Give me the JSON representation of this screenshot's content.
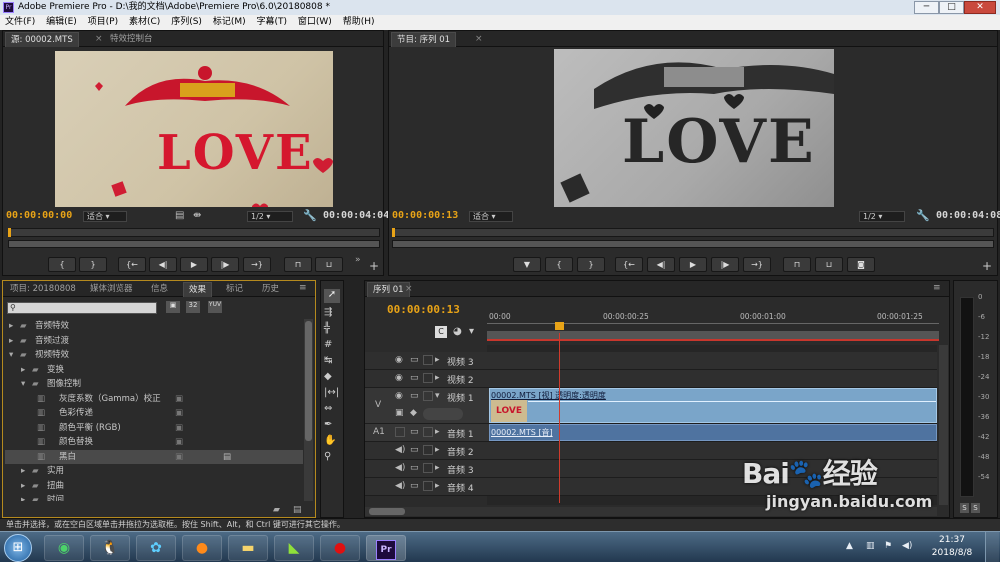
{
  "window": {
    "title": "Adobe Premiere Pro - D:\\我的文档\\Adobe\\Premiere Pro\\6.0\\20180808 *",
    "app_icon": "Pr",
    "minimize": "─",
    "maximize": "□",
    "close": "✕"
  },
  "menu": [
    "文件(F)",
    "编辑(E)",
    "项目(P)",
    "素材(C)",
    "序列(S)",
    "标记(M)",
    "字幕(T)",
    "窗口(W)",
    "帮助(H)"
  ],
  "source_monitor": {
    "tab_source": "源: 00002.MTS",
    "tab_effect_controls": "特效控制台",
    "timecode_in": "00:00:00:00",
    "fit": "适合",
    "resolution": "1/2",
    "duration": "00:00:04:04",
    "frame_text": "LOVE"
  },
  "program_monitor": {
    "tab": "节目: 序列 01",
    "timecode": "00:00:00:13",
    "fit": "适合",
    "resolution": "1/2",
    "duration": "00:00:04:08",
    "frame_text": "LOVE"
  },
  "project_panel": {
    "tabs": [
      "项目: 20180808",
      "媒体浏览器",
      "信息",
      "效果",
      "标记",
      "历史"
    ],
    "active_tab": "效果",
    "tree": [
      {
        "label": "音频特效",
        "level": 0,
        "expanded": false,
        "folder": true
      },
      {
        "label": "音频过渡",
        "level": 0,
        "expanded": false,
        "folder": true
      },
      {
        "label": "视频特效",
        "level": 0,
        "expanded": true,
        "folder": true
      },
      {
        "label": "变换",
        "level": 1,
        "expanded": false,
        "folder": true
      },
      {
        "label": "图像控制",
        "level": 1,
        "expanded": true,
        "folder": true
      },
      {
        "label": "灰度系数（Gamma）校正",
        "level": 2,
        "folder": false
      },
      {
        "label": "色彩传递",
        "level": 2,
        "folder": false
      },
      {
        "label": "颜色平衡 (RGB)",
        "level": 2,
        "folder": false
      },
      {
        "label": "颜色替换",
        "level": 2,
        "folder": false
      },
      {
        "label": "黑白",
        "level": 2,
        "folder": false,
        "selected": true
      },
      {
        "label": "实用",
        "level": 1,
        "expanded": false,
        "folder": true
      },
      {
        "label": "扭曲",
        "level": 1,
        "expanded": false,
        "folder": true
      },
      {
        "label": "时间",
        "level": 1,
        "expanded": false,
        "folder": true
      }
    ]
  },
  "timeline": {
    "tab": "序列 01",
    "timecode": "00:00:00:13",
    "ruler": [
      "00:00",
      "00:00:00:25",
      "00:00:01:00",
      "00:00:01:25"
    ],
    "video_header": "V",
    "audio_header": "A1",
    "video_tracks": [
      "视频 3",
      "视频 2",
      "视频 1"
    ],
    "audio_tracks": [
      "音频 1",
      "音频 2",
      "音频 3",
      "音频 4"
    ],
    "clip_video_label": "00002.MTS [视] 透明度:透明度",
    "clip_audio_label": "00002.MTS [音]"
  },
  "meter_scale": [
    "0",
    "-6",
    "-12",
    "-18",
    "-24",
    "-30",
    "-36",
    "-42",
    "-48",
    "-54"
  ],
  "meter_buttons": [
    "S",
    "S"
  ],
  "status_bar": "单击并选择，或在空白区域单击并拖拉为选取框。按住 Shift、Alt，和 Ctrl 键可进行其它操作。",
  "taskbar": {
    "time": "21:37",
    "date": "2018/8/8",
    "apps": [
      "360",
      "QQ",
      "媒体",
      "Firefox",
      "资源管理器",
      "播放器",
      "录屏",
      "Pr"
    ]
  },
  "watermark": "Bai 经验 jingyan.baidu.com"
}
